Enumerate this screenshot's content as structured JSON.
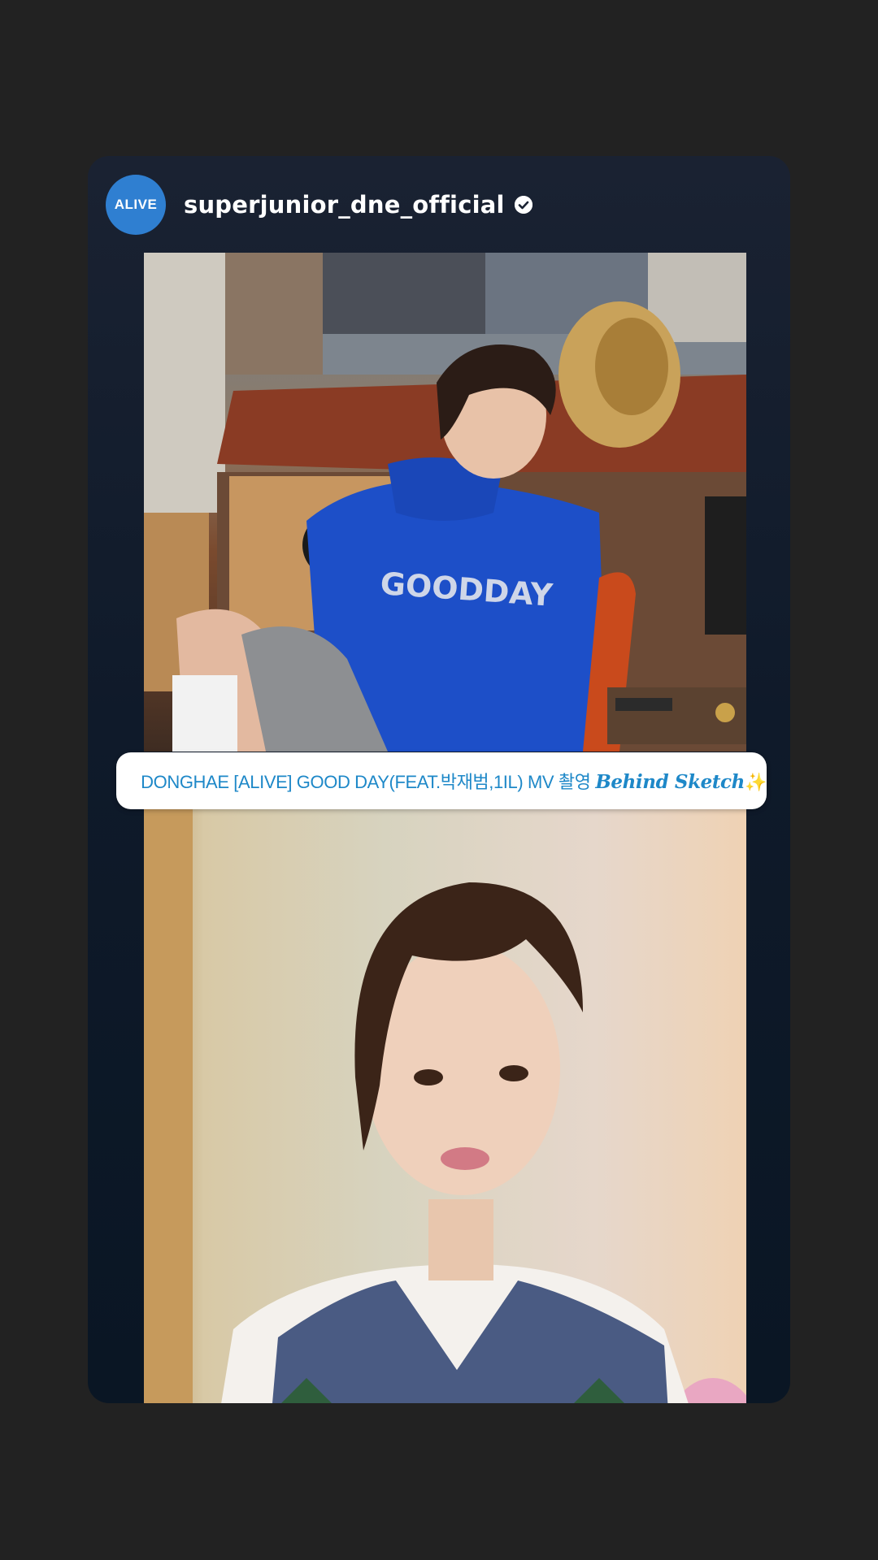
{
  "post": {
    "avatar_text": "ALIVE",
    "username": "superjunior_dne_official",
    "verified_icon": "verified-badge-icon"
  },
  "link_sticker": {
    "icon": "link-icon",
    "text_main": "DONGHAE [ALIVE] GOOD DAY(FEAT.박재범,1IL) MV 촬영 ",
    "text_emph": "Behind Sketch",
    "sparkle": "✨"
  },
  "colors": {
    "background": "#222222",
    "card": "#0f1a2a",
    "avatar": "#2f7fd1",
    "link_text": "#1e88c8"
  }
}
